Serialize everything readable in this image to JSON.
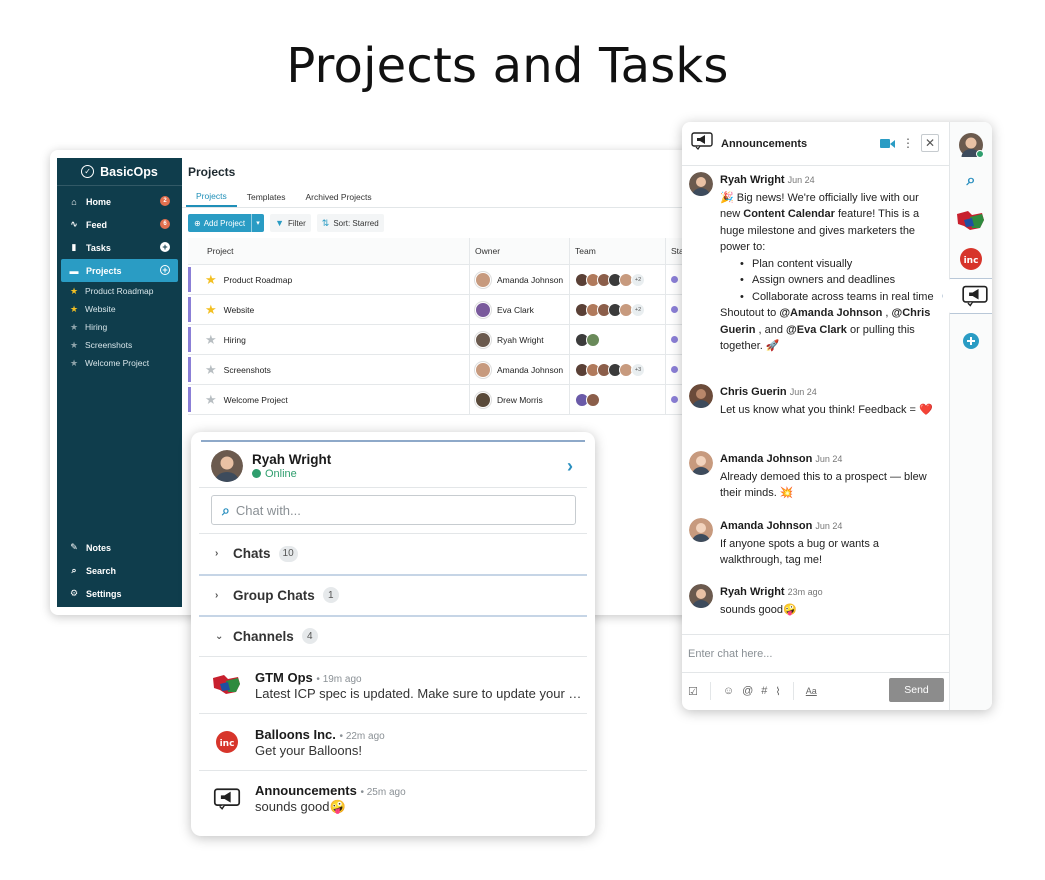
{
  "headline": "Projects and Tasks",
  "app": {
    "brand": "BasicOps",
    "nav": [
      {
        "label": "Home",
        "icon": "home-icon",
        "badge": "2"
      },
      {
        "label": "Feed",
        "icon": "pulse-icon",
        "badge": "6"
      },
      {
        "label": "Tasks",
        "icon": "clipboard-icon",
        "badge": "+"
      },
      {
        "label": "Projects",
        "icon": "folder-icon",
        "badge": "+"
      }
    ],
    "project_list": [
      {
        "label": "Product Roadmap",
        "starred": true
      },
      {
        "label": "Website",
        "starred": true
      },
      {
        "label": "Hiring",
        "starred": false
      },
      {
        "label": "Screenshots",
        "starred": false
      },
      {
        "label": "Welcome Project",
        "starred": false
      }
    ],
    "bottom_nav": [
      {
        "label": "Notes",
        "icon": "pencil-icon"
      },
      {
        "label": "Search",
        "icon": "search-icon"
      },
      {
        "label": "Settings",
        "icon": "gear-icon"
      }
    ],
    "page_title": "Projects",
    "tabs": [
      "Projects",
      "Templates",
      "Archived Projects"
    ],
    "toolbar": {
      "add": "Add Project",
      "filter": "Filter",
      "sort": "Sort: Starred"
    },
    "columns": {
      "project": "Project",
      "owner": "Owner",
      "team": "Team",
      "status": "Sta"
    },
    "rows": [
      {
        "project": "Product Roadmap",
        "starred": true,
        "owner": "Amanda Johnson",
        "team_more": "+2"
      },
      {
        "project": "Website",
        "starred": true,
        "owner": "Eva Clark",
        "team_more": "+2"
      },
      {
        "project": "Hiring",
        "starred": false,
        "owner": "Ryah Wright",
        "team_more": ""
      },
      {
        "project": "Screenshots",
        "starred": false,
        "owner": "Amanda Johnson",
        "team_more": "+3"
      },
      {
        "project": "Welcome Project",
        "starred": false,
        "owner": "Drew Morris",
        "team_more": ""
      }
    ]
  },
  "chat_popup": {
    "user": "Ryah Wright",
    "status": "Online",
    "search_placeholder": "Chat with...",
    "sections": [
      {
        "label": "Chats",
        "count": "10"
      },
      {
        "label": "Group Chats",
        "count": "1"
      },
      {
        "label": "Channels",
        "count": "4"
      }
    ],
    "channels": [
      {
        "name": "GTM Ops",
        "time": "19m ago",
        "message": "Latest ICP spec is updated. Make sure to update your CRM..."
      },
      {
        "name": "Balloons Inc.",
        "time": "22m ago",
        "message": "Get your Balloons!"
      },
      {
        "name": "Announcements",
        "time": "25m ago",
        "message": "sounds good🤪"
      }
    ]
  },
  "announcements": {
    "title": "Announcements",
    "messages": [
      {
        "name": "Ryah Wright",
        "time": "Jun 24"
      },
      {
        "name": "Chris Guerin",
        "time": "Jun 24",
        "text": "Let us know what you think! Feedback = ❤️"
      },
      {
        "name": "Amanda Johnson",
        "time": "Jun 24",
        "text": "Already demoed this to a prospect — blew their minds. 💥"
      },
      {
        "name": "Amanda Johnson",
        "time": "Jun 24",
        "text": "If anyone spots a bug or wants a walkthrough, tag me!"
      },
      {
        "name": "Ryah Wright",
        "time": "23m ago",
        "text": "sounds good🤪"
      }
    ],
    "first_message": {
      "intro_pre": "🎉 Big news! We're officially live with our new ",
      "intro_bold": "Content Calendar",
      "intro_post": " feature! This is a huge milestone and gives marketers the power to:",
      "bullets": [
        "Plan content visually",
        "Assign owners and deadlines",
        "Collaborate across teams in real time"
      ],
      "shout_pre": "Shoutout to ",
      "mention1": "@Amanda Johnson",
      "shout_mid1": " , ",
      "mention2": "@Chris Guerin",
      "shout_mid2": " , and ",
      "mention3": "@Eva Clark",
      "shout_post": " or pulling this together. 🚀"
    },
    "composer_placeholder": "Enter chat here...",
    "send": "Send"
  },
  "colors": {
    "sidebar": "#0f3d4c",
    "accent": "#2a9cc4",
    "status": "#8b7fd6",
    "online": "#2f9e6e"
  }
}
